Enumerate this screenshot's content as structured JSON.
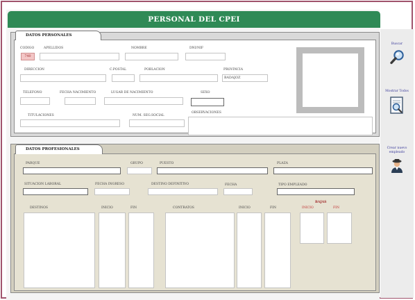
{
  "window": {
    "title": "PERSONAL DEL CPEI"
  },
  "personal": {
    "tab": "DATOS PERSONALES",
    "labels": {
      "codigo": "CODIGO",
      "apellidos": "APELLIDOS",
      "nombre": "NOMBRE",
      "dni": "DNI/NIF",
      "direccion": "DIRECCION",
      "cpostal": "C.POSTAL",
      "poblacion": "POBLACION",
      "provincia": "PROVINCIA",
      "telefono": "TELEFONO",
      "fecha_nac": "FECHA NACIMIENTO",
      "lugar_nac": "LUGAR DE NACIMIENTO",
      "sexo": "SEXO",
      "titulaciones": "TITULACIONES",
      "seg_social": "NUM. SEG.SOCIAL",
      "observaciones": "OBSERVACIONES"
    },
    "values": {
      "codigo": "740",
      "provincia": "BADAJOZ"
    }
  },
  "professional": {
    "tab": "DATOS PROFESIONALES",
    "labels": {
      "parque": "PARQUE",
      "grupo": "GRUPO",
      "puesto": "PUESTO",
      "plaza": "PLAZA",
      "situacion": "SITUACION LABORAL",
      "fecha_ingreso": "FECHA INGRESO",
      "destino_def": "DESTINO DEFINITIVO",
      "fecha": "FECHA",
      "tipo_empleado": "TIPO EMPLEADO",
      "destinos": "DESTINOS",
      "inicio": "INICIO",
      "fin": "FIN",
      "contratos": "CONTRATOS",
      "inicio2": "INICIO",
      "fin2": "FIN",
      "bajas": "BAJAS",
      "bajas_inicio": "INICIO",
      "bajas_fin": "FIN"
    }
  },
  "sidebar": {
    "buscar": "Buscar",
    "mostrar": "Mostrar Todos",
    "crear_line1": "Crear nuevo",
    "crear_line2": "empleado"
  },
  "icons": [
    "magnifier-icon",
    "document-search-icon",
    "new-employee-icon"
  ],
  "colors": {
    "title_bar": "#2f8a56",
    "frame": "#a0536c",
    "link": "#3a3a9a",
    "accent_red": "#c03030"
  }
}
